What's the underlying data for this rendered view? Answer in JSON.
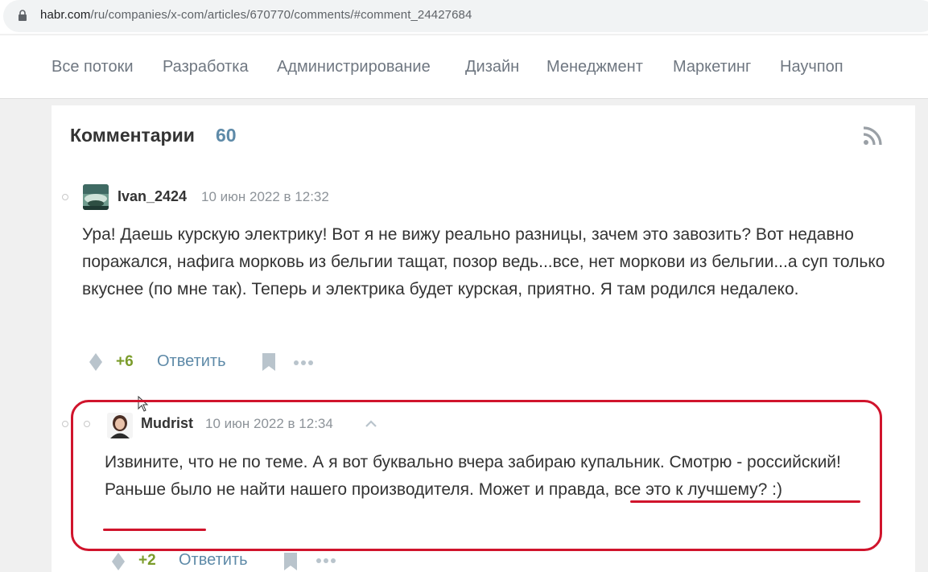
{
  "browser": {
    "url_host": "habr.com",
    "url_path": "/ru/companies/x-com/articles/670770/comments/#comment_24427684"
  },
  "nav": {
    "items": [
      "Все потоки",
      "Разработка",
      "Администрирование",
      "Дизайн",
      "Менеджмент",
      "Маркетинг",
      "Научпоп"
    ]
  },
  "comments": {
    "title": "Комментарии",
    "count": "60",
    "list": [
      {
        "username": "Ivan_2424",
        "datetime": "10 июн 2022 в 12:32",
        "text": "Ура! Даешь курскую электрику! Вот я не вижу реально разницы, зачем это завозить? Вот недавно поражался, нафига морковь из бельгии тащат, позор ведь...все, нет моркови из бельгии...а суп только вкуснее (по мне так). Теперь и электрика будет курская, приятно. Я там родился недалеко.",
        "score": "+6",
        "reply_label": "Ответить"
      },
      {
        "username": "Mudrist",
        "datetime": "10 июн 2022 в 12:34",
        "text": "Извините, что не по теме. А я вот буквально вчера забираю купальник. Смотрю - российский! Раньше было не найти нашего производителя. Может и правда, все это к лучшему? :)",
        "score": "+2",
        "reply_label": "Ответить"
      }
    ]
  },
  "colors": {
    "link": "#5e8aa8",
    "score_positive": "#7b9c2b",
    "annotation_red": "#d0142c"
  }
}
